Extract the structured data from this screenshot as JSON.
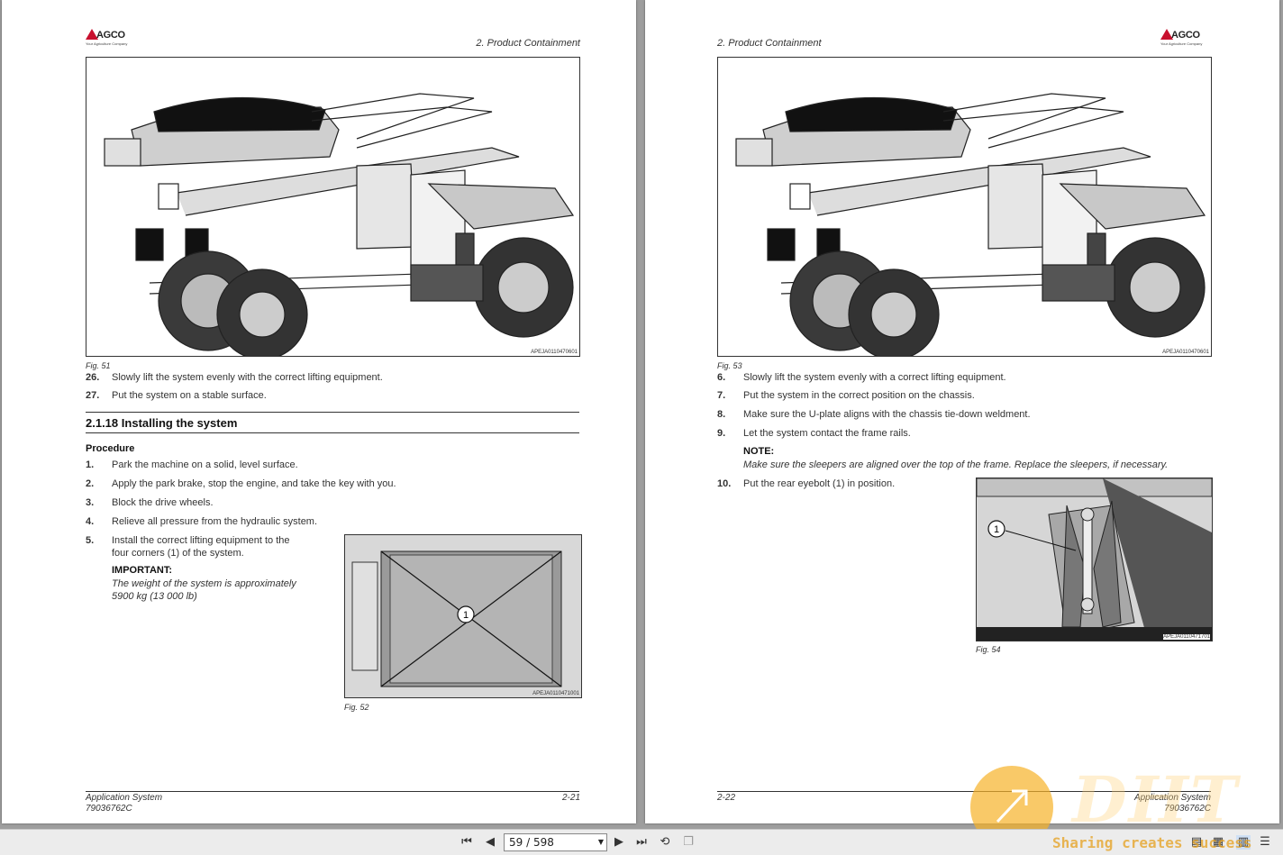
{
  "left_page": {
    "logo": {
      "word": "AGCO",
      "tagline": "Your Agriculture Company"
    },
    "header": "2. Product Containment",
    "figure_top": {
      "code": "APEJA0110470601",
      "caption": "Fig. 51"
    },
    "steps_top": [
      {
        "num": "26.",
        "text": "Slowly lift the system evenly with the correct lifting equipment."
      },
      {
        "num": "27.",
        "text": "Put the system on a stable surface."
      }
    ],
    "section": {
      "number": "2.1.18",
      "title": "Installing the system"
    },
    "procedure_label": "Procedure",
    "steps": [
      {
        "num": "1.",
        "text": "Park the machine on a solid, level surface."
      },
      {
        "num": "2.",
        "text": "Apply the park brake, stop the engine, and take the key with you."
      },
      {
        "num": "3.",
        "text": "Block the drive wheels."
      },
      {
        "num": "4.",
        "text": "Relieve all pressure from the hydraulic system."
      },
      {
        "num": "5.",
        "text": "Install the correct lifting equipment to the",
        "text2": "four corners (1) of the system."
      }
    ],
    "important": {
      "label": "IMPORTANT:",
      "line1": "The weight of the system is approximately",
      "line2": "5900 kg (13 000 lb)"
    },
    "figure_small": {
      "code": "APEJA0110471001",
      "caption": "Fig. 52",
      "callout": "1"
    },
    "footer": {
      "left1": "Application System",
      "left2": "79036762C",
      "right": "2-21"
    }
  },
  "right_page": {
    "logo": {
      "word": "AGCO",
      "tagline": "Your Agriculture Company"
    },
    "header": "2. Product Containment",
    "figure_top": {
      "code": "APEJA0110470601",
      "caption": "Fig. 53"
    },
    "steps": [
      {
        "num": "6.",
        "text": "Slowly lift the system evenly with a correct lifting equipment."
      },
      {
        "num": "7.",
        "text": "Put the system in the correct position on the chassis."
      },
      {
        "num": "8.",
        "text": "Make sure the U-plate aligns with the chassis tie-down weldment."
      },
      {
        "num": "9.",
        "text": "Let the system contact the frame rails."
      }
    ],
    "note": {
      "label": "NOTE:",
      "text": "Make sure the sleepers are aligned over the top of the frame. Replace the sleepers, if necessary."
    },
    "step10": {
      "num": "10.",
      "text": "Put the rear eyebolt (1) in position."
    },
    "figure_small": {
      "code": "APEJA0110471701",
      "caption": "Fig. 54",
      "callout": "1"
    },
    "footer": {
      "left": "2-22",
      "right1": "Application System",
      "right2": "79036762C"
    }
  },
  "toolbar": {
    "page_indicator": "59 / 598",
    "icons": [
      "first-page-icon",
      "prev-page-icon",
      "next-page-icon",
      "last-page-icon",
      "rotate-icon",
      "copy-icon",
      "view-icon"
    ]
  },
  "watermark": {
    "big": "DHT",
    "text": "Sharing creates success"
  }
}
